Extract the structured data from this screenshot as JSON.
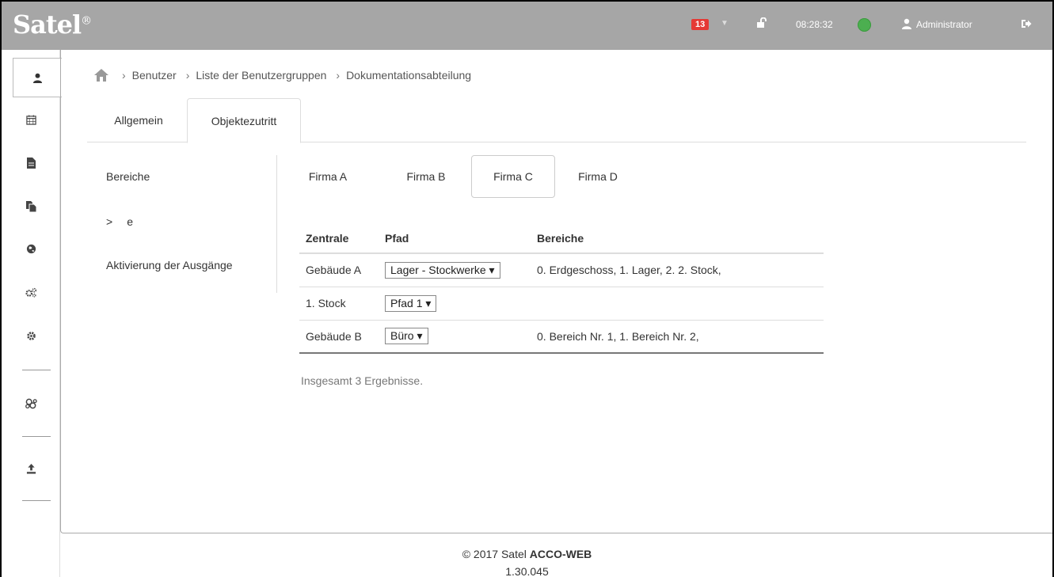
{
  "header": {
    "logo": "Satel",
    "logo_mark": "®",
    "alert_count": "13",
    "time": "08:28:32",
    "status_color": "#4caf50",
    "user": "Administrator"
  },
  "sidebar": {
    "items": [
      {
        "icon": "user-icon"
      },
      {
        "icon": "calendar-icon"
      },
      {
        "icon": "document-icon"
      },
      {
        "icon": "copy-icon"
      },
      {
        "icon": "globe-icon"
      },
      {
        "icon": "gears-icon"
      },
      {
        "icon": "gear-icon"
      },
      {
        "icon": "network-icon"
      },
      {
        "icon": "upload-icon"
      }
    ]
  },
  "breadcrumb": {
    "items": [
      "Benutzer",
      "Liste der Benutzergruppen",
      "Dokumentationsabteilung"
    ]
  },
  "main_tabs": [
    "Allgemein",
    "Objektezutritt"
  ],
  "left_nav": {
    "item1": "Bereiche",
    "item2_chevron": ">",
    "item2": "e",
    "item3": "Aktivierung der Ausgänge"
  },
  "firm_tabs": [
    "Firma A",
    "Firma B",
    "Firma C",
    "Firma D"
  ],
  "table": {
    "headers": [
      "Zentrale",
      "Pfad",
      "Bereiche"
    ],
    "rows": [
      {
        "zentrale": "Gebäude A",
        "pfad": "Lager - Stockwerke",
        "bereiche": "0. Erdgeschoss, 1. Lager, 2. 2. Stock,"
      },
      {
        "zentrale": "1. Stock",
        "pfad": "Pfad 1",
        "bereiche": ""
      },
      {
        "zentrale": "Gebäude B",
        "pfad": "Büro",
        "bereiche": "0. Bereich Nr. 1, 1. Bereich Nr. 2,"
      }
    ]
  },
  "total": "Insgesamt 3 Ergebnisse.",
  "footer": {
    "copyright": "© 2017 Satel ",
    "product": "ACCO-WEB",
    "version": "1.30.045"
  }
}
